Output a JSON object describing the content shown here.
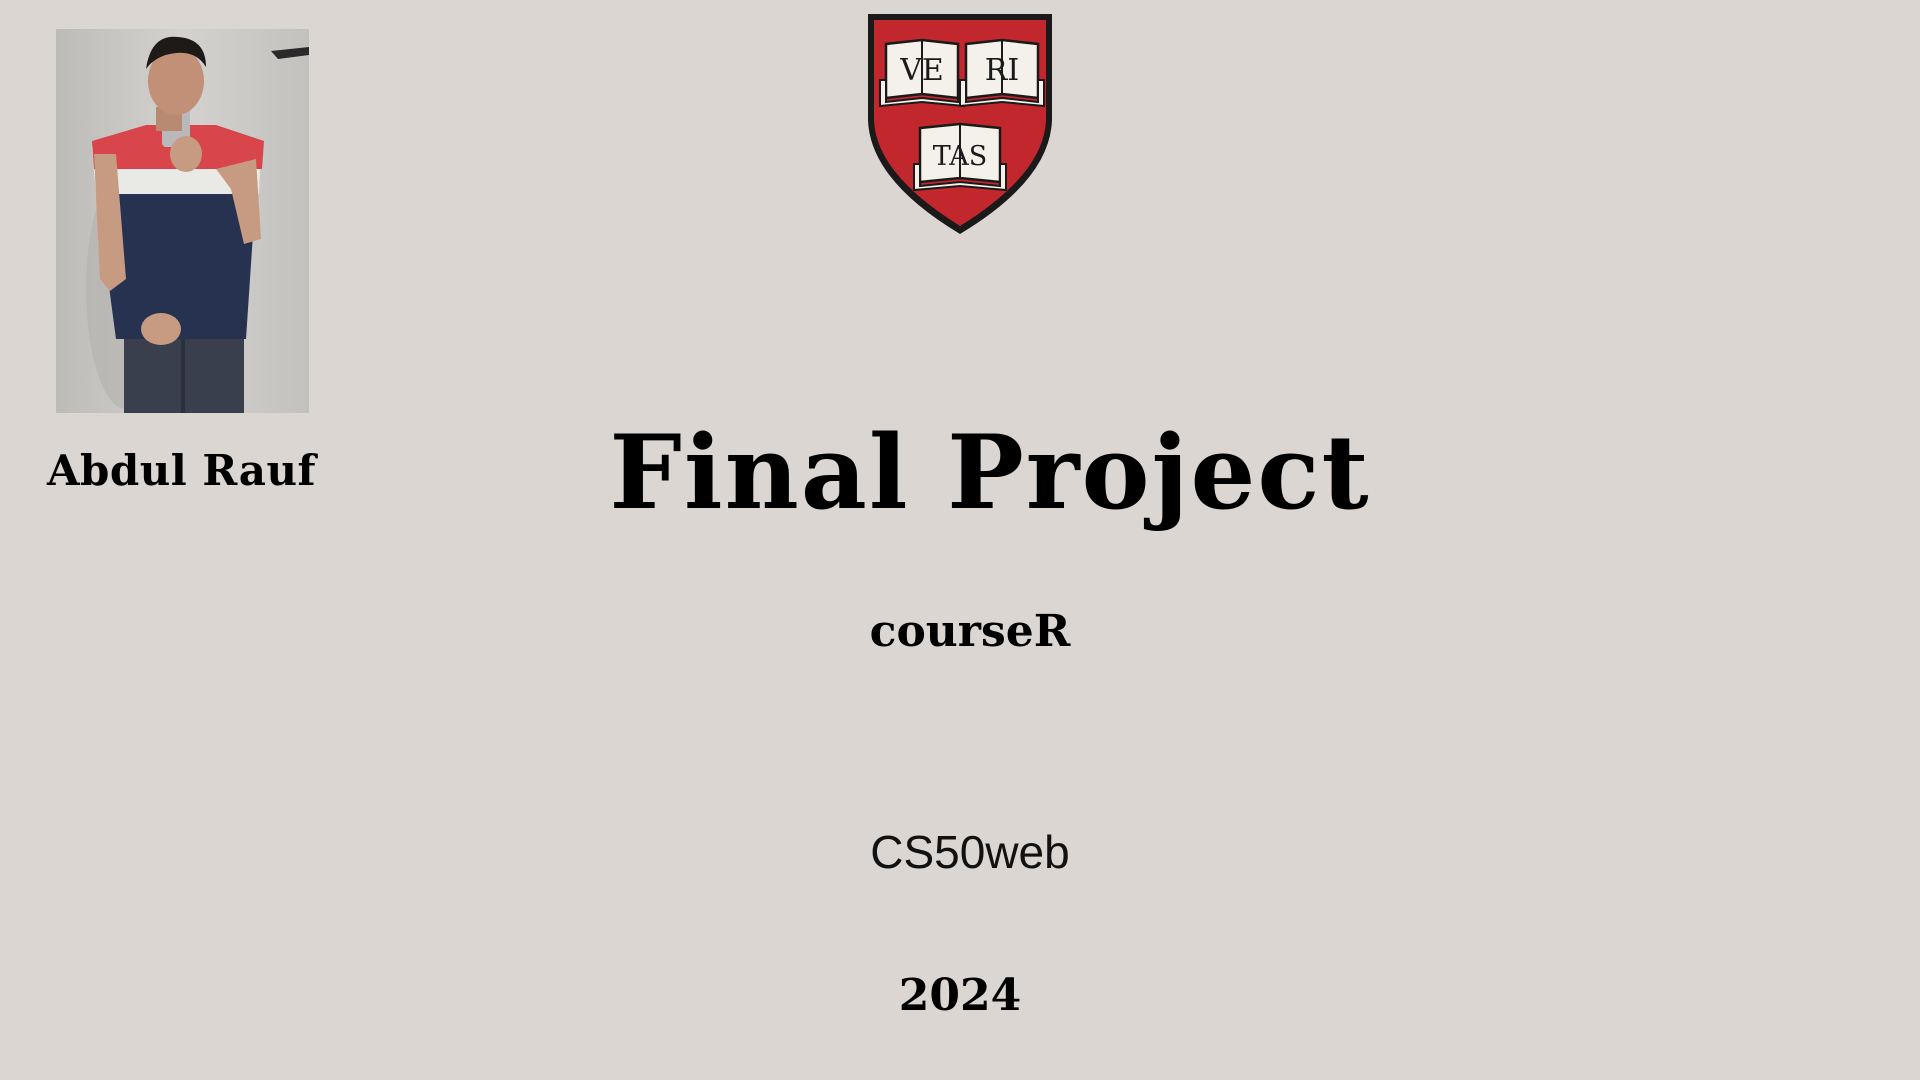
{
  "slide": {
    "author_name": "Abdul Rauf",
    "title": "Final Project",
    "subtitle": "courseR",
    "course": "CS50web",
    "year": "2024"
  },
  "logo": {
    "icon": "harvard-veritas-shield-icon",
    "books": [
      "VE",
      "RI",
      "TAS"
    ],
    "colors": {
      "field": "#c1272d",
      "outline": "#1a1a1a",
      "book_page": "#f4f1ea"
    }
  },
  "photo": {
    "icon": "portrait-photo"
  },
  "colors": {
    "background": "#dbd6d2",
    "text": "#000000"
  }
}
